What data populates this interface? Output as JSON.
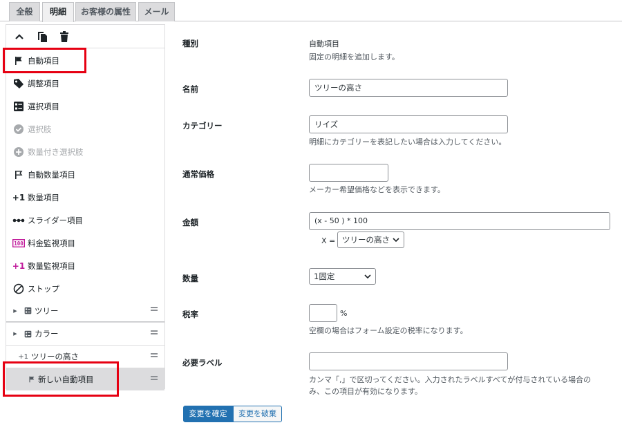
{
  "tabs": [
    {
      "label": "全般"
    },
    {
      "label": "明細"
    },
    {
      "label": "お客様の属性"
    },
    {
      "label": "メール"
    }
  ],
  "sidebar": {
    "toolbar": {
      "collapse_icon": "chevron-up-icon",
      "copy_icon": "copy-icon",
      "delete_icon": "trash-icon"
    },
    "items": [
      {
        "label": "自動項目",
        "icon": "flag-icon"
      },
      {
        "label": "調整項目",
        "icon": "tag-icon"
      },
      {
        "label": "選択項目",
        "icon": "list-icon"
      },
      {
        "label": "選択肢",
        "icon": "check-circle-icon"
      },
      {
        "label": "数量付き選択肢",
        "icon": "plus-circle-icon"
      },
      {
        "label": "自動数量項目",
        "icon": "flag-outline-icon"
      },
      {
        "label": "数量項目",
        "icon": "plus-one-icon"
      },
      {
        "label": "スライダー項目",
        "icon": "slider-icon"
      },
      {
        "label": "料金監視項目",
        "icon": "counter-icon"
      },
      {
        "label": "数量監視項目",
        "icon": "plus-one-icon"
      },
      {
        "label": "ストップ",
        "icon": "stop-icon"
      }
    ],
    "tree": [
      {
        "label": "ツリー",
        "icon": "list-icon"
      },
      {
        "label": "カラー",
        "icon": "list-icon"
      },
      {
        "label": "ツリーの高さ",
        "icon": "plus-one-icon",
        "prefix": "+1"
      },
      {
        "label": "新しい自動項目",
        "icon": "flag-icon"
      }
    ]
  },
  "form": {
    "type": {
      "label": "種別",
      "value": "自動項目",
      "help": "固定の明細を追加します。"
    },
    "name": {
      "label": "名前",
      "value": "ツリーの高さ"
    },
    "category": {
      "label": "カテゴリー",
      "value": "リイズ",
      "help": "明細にカテゴリーを表記したい場合は入力してください。"
    },
    "price": {
      "label": "通常価格",
      "value": "",
      "help": "メーカー希望価格などを表示できます。"
    },
    "amount": {
      "label": "金額",
      "value": "(x - 50 ) * 100",
      "x_label": "X =",
      "x_select": "ツリーの高さ"
    },
    "quantity": {
      "label": "数量",
      "value": "1固定"
    },
    "tax": {
      "label": "税率",
      "value": "",
      "unit": "%",
      "help": "空欄の場合はフォーム設定の税率になります。"
    },
    "required_label": {
      "label": "必要ラベル",
      "value": "",
      "help1": "カンマ「,」で区切ってください。入力されたラベルすべてが付与されている場合の",
      "help2": "み、この項目が有効になります。"
    }
  },
  "buttons": {
    "apply": "変更を確定",
    "discard": "変更を破棄"
  },
  "colors": {
    "accent": "#2271b1",
    "highlight": "#e60012",
    "plus_pink": "#c0199a"
  }
}
